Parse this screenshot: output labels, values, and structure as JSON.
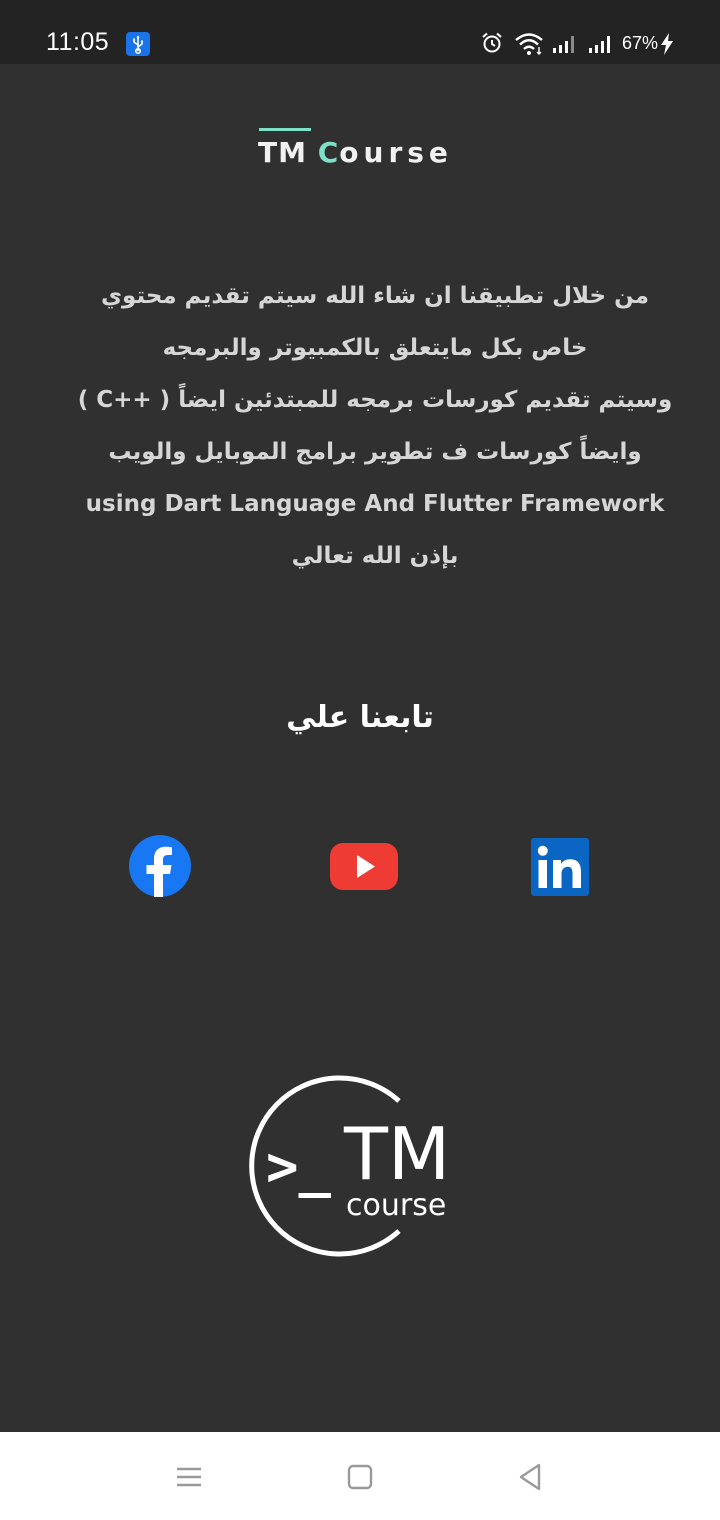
{
  "status_bar": {
    "time": "11:05",
    "battery": "67%",
    "icons": [
      "usb-icon",
      "alarm-icon",
      "wifi-icon",
      "signal-icon",
      "signal-icon",
      "charging-bolt-icon"
    ]
  },
  "brand": {
    "tm": "TM",
    "c": "C",
    "rest": "ourse",
    "accent_color": "#7fe0c8"
  },
  "intro_lines": [
    "من خلال تطبيقنا ان شاء الله سيتم تقديم محتوي",
    "خاص بكل مايتعلق بالكمبيوتر والبرمجه",
    "وسيتم تقديم كورسات برمجه للمبتدئين ايضاً ( ++C )",
    "وايضاً كورسات  ف تطوير برامج الموبايل والويب",
    "using Dart Language And Flutter Framework",
    "بإذن الله تعالي"
  ],
  "follow_title": "تابعنا علي",
  "social": [
    {
      "name": "facebook-icon",
      "color": "#1877f2"
    },
    {
      "name": "youtube-icon",
      "color": "#ee3b33"
    },
    {
      "name": "linkedin-icon",
      "color": "#0a66c2"
    }
  ],
  "logo": {
    "prompt": ">_",
    "tm": "TM",
    "course": "course"
  },
  "nav_bar": {
    "icons": [
      "menu-icon",
      "home-square-icon",
      "back-triangle-icon"
    ]
  }
}
